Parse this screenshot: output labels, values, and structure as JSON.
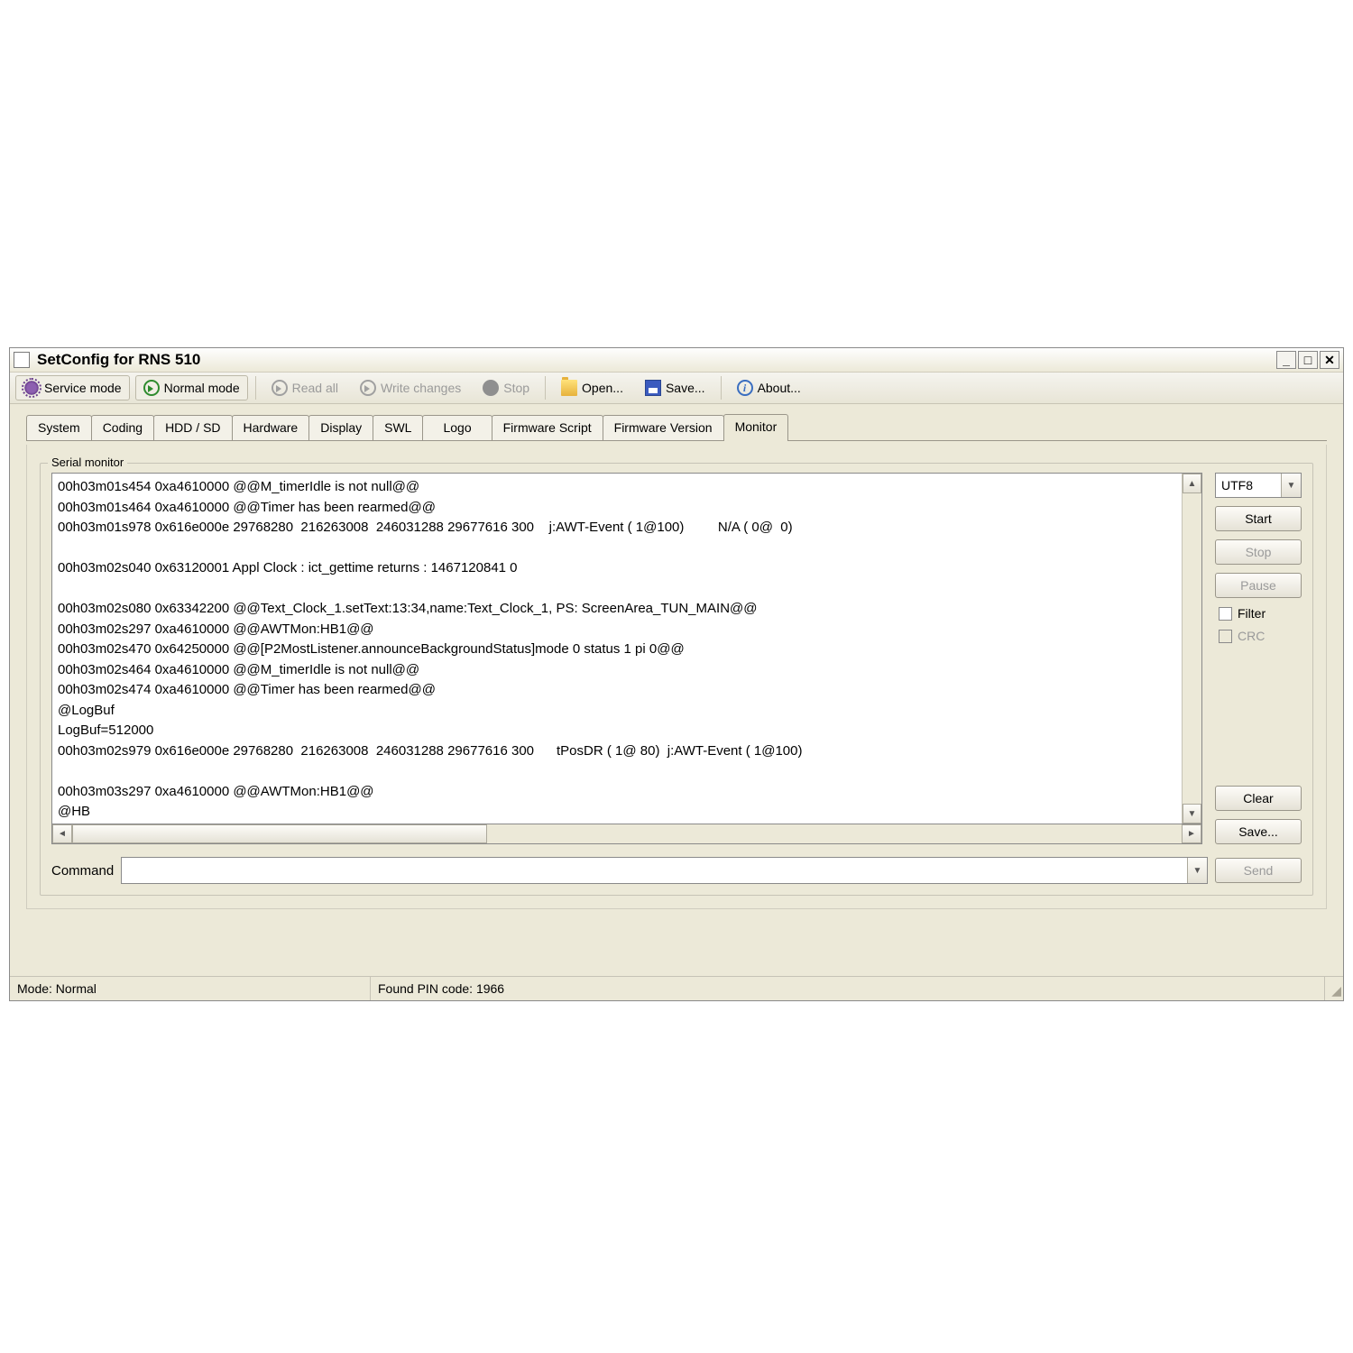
{
  "window": {
    "title": "SetConfig for RNS 510"
  },
  "toolbar": {
    "service_mode": "Service mode",
    "normal_mode": "Normal mode",
    "read_all": "Read all",
    "write_changes": "Write changes",
    "stop": "Stop",
    "open": "Open...",
    "save": "Save...",
    "about": "About..."
  },
  "tabs": {
    "system": "System",
    "coding": "Coding",
    "hdd_sd": "HDD / SD",
    "hardware": "Hardware",
    "display": "Display",
    "swl": "SWL",
    "logo": "Logo",
    "firmware_script": "Firmware Script",
    "firmware_version": "Firmware Version",
    "monitor": "Monitor"
  },
  "group": {
    "title": "Serial monitor"
  },
  "log_lines": "00h03m01s454 0xa4610000 @@M_timerIdle is not null@@\n00h03m01s464 0xa4610000 @@Timer has been rearmed@@\n00h03m01s978 0x616e000e 29768280  216263008  246031288 29677616 300    j:AWT-Event ( 1@100)         N/A ( 0@  0)\n\n00h03m02s040 0x63120001 Appl Clock : ict_gettime returns : 1467120841 0\n\n00h03m02s080 0x63342200 @@Text_Clock_1.setText:13:34,name:Text_Clock_1, PS: ScreenArea_TUN_MAIN@@\n00h03m02s297 0xa4610000 @@AWTMon:HB1@@\n00h03m02s470 0x64250000 @@[P2MostListener.announceBackgroundStatus]mode 0 status 1 pi 0@@\n00h03m02s464 0xa4610000 @@M_timerIdle is not null@@\n00h03m02s474 0xa4610000 @@Timer has been rearmed@@\n@LogBuf\nLogBuf=512000\n00h03m02s979 0x616e000e 29768280  216263008  246031288 29677616 300      tPosDR ( 1@ 80)  j:AWT-Event ( 1@100)\n\n00h03m03s297 0xa4610000 @@AWTMon:HB1@@\n@HB",
  "side": {
    "encoding": "UTF8",
    "start": "Start",
    "stop": "Stop",
    "pause": "Pause",
    "filter": "Filter",
    "crc": "CRC",
    "clear": "Clear",
    "save": "Save...",
    "send": "Send"
  },
  "command": {
    "label": "Command",
    "value": ""
  },
  "status": {
    "mode": "Mode: Normal",
    "pin": "Found PIN code: 1966"
  }
}
